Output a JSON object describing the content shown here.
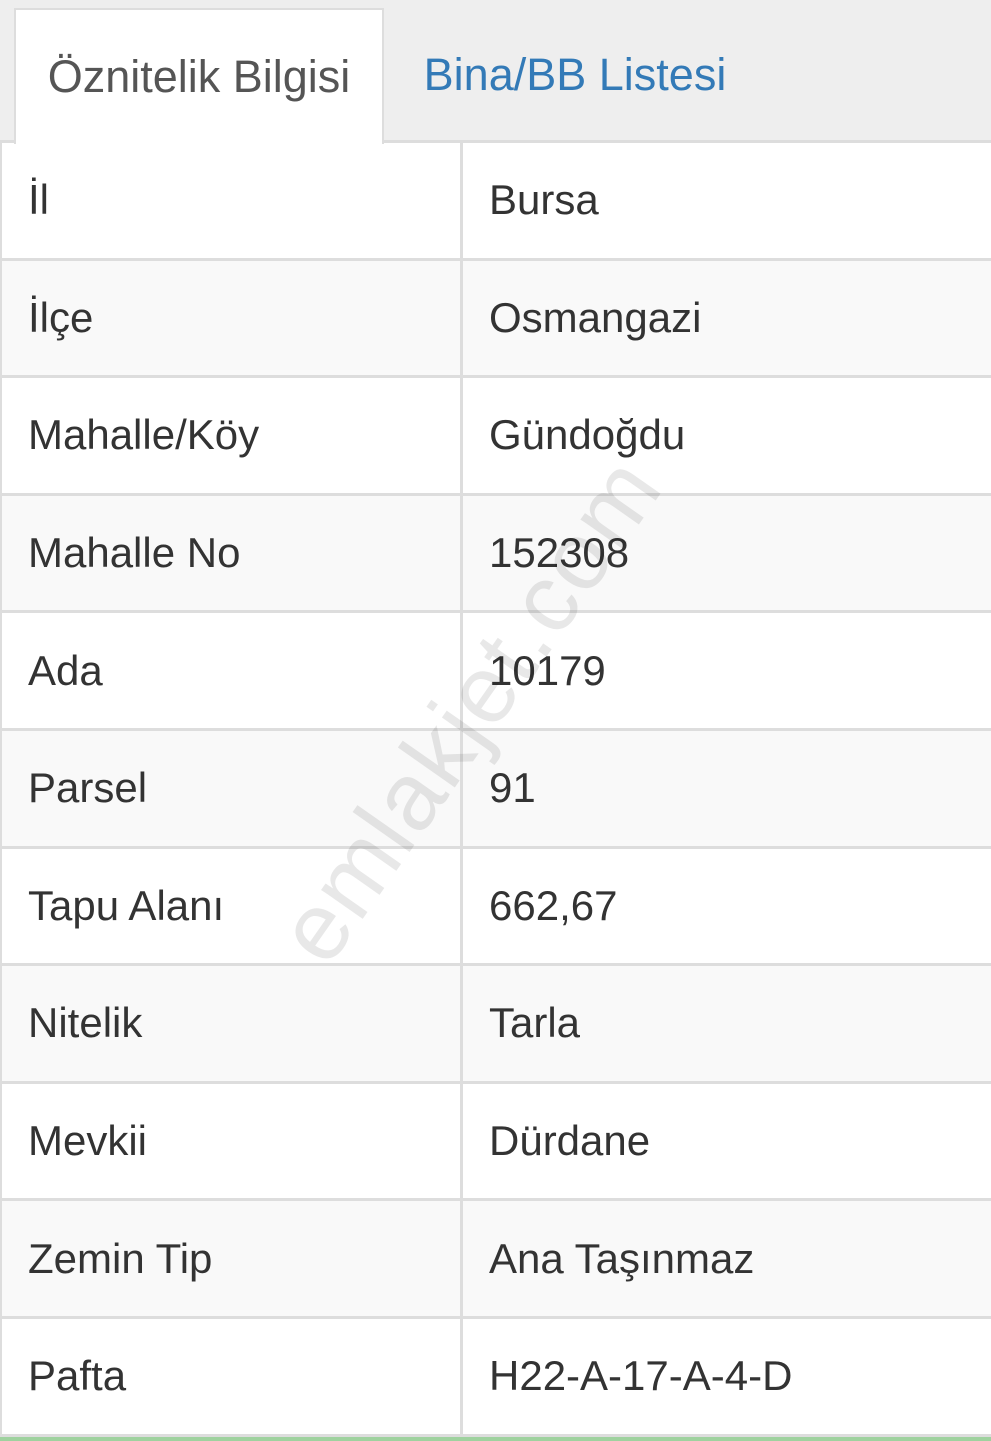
{
  "tabs": [
    {
      "label": "Öznitelik Bilgisi",
      "active": true
    },
    {
      "label": "Bina/BB Listesi",
      "active": false
    }
  ],
  "rows": [
    {
      "label": "İl",
      "value": "Bursa"
    },
    {
      "label": "İlçe",
      "value": "Osmangazi"
    },
    {
      "label": "Mahalle/Köy",
      "value": "Gündoğdu"
    },
    {
      "label": "Mahalle No",
      "value": "152308"
    },
    {
      "label": "Ada",
      "value": "10179"
    },
    {
      "label": "Parsel",
      "value": "91"
    },
    {
      "label": "Tapu Alanı",
      "value": "662,67"
    },
    {
      "label": "Nitelik",
      "value": "Tarla"
    },
    {
      "label": "Mevkii",
      "value": "Dürdane"
    },
    {
      "label": "Zemin Tip",
      "value": "Ana Taşınmaz"
    },
    {
      "label": "Pafta",
      "value": "H22-A-17-A-4-D"
    }
  ],
  "watermark": "emlakjet.com",
  "colors": {
    "tab_link": "#337ab7",
    "border": "#dddddd",
    "text": "#333333"
  }
}
